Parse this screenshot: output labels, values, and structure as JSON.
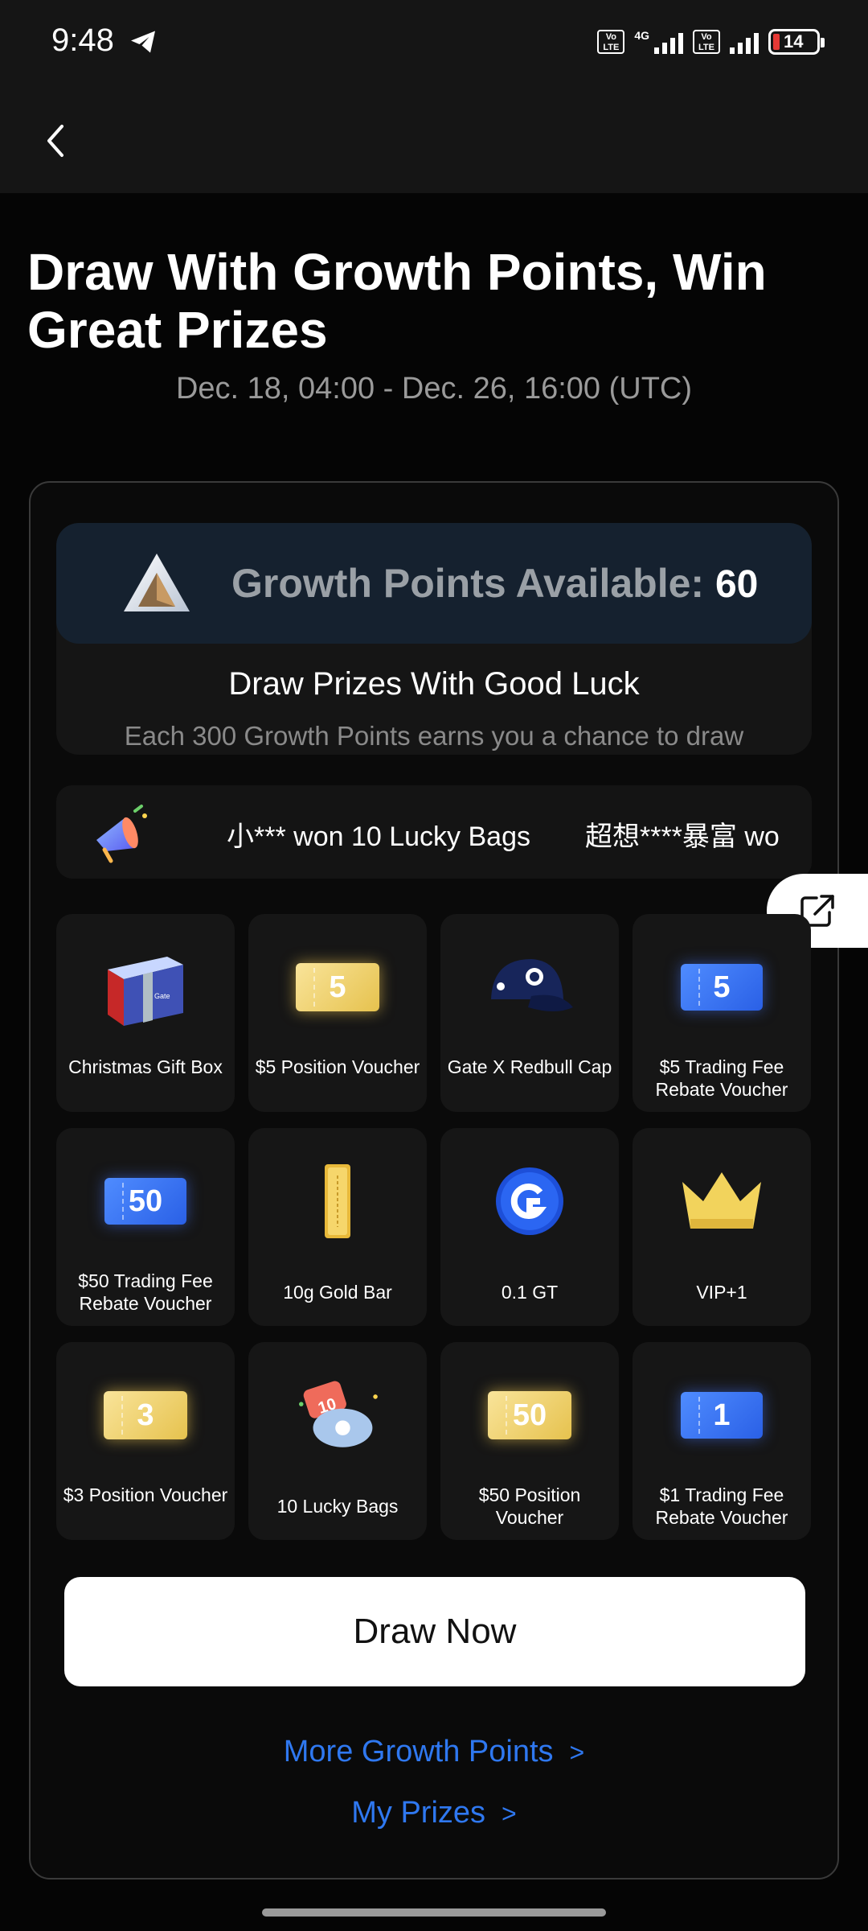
{
  "status_bar": {
    "time": "9:48",
    "network_type": "4G",
    "volte_label": "Vo LTE",
    "battery_level": "14",
    "battery_color": "#e53935"
  },
  "nav": {
    "back_icon": "chevron-left-icon"
  },
  "header": {
    "title": "Draw With Growth Points, Win Great Prizes",
    "date_range": "Dec. 18, 04:00 - Dec. 26, 16:00 (UTC)"
  },
  "points": {
    "label": "Growth Points Available:",
    "value": "60",
    "heading": "Draw Prizes With Good Luck",
    "subtext": "Each 300 Growth Points earns you a chance to draw"
  },
  "ticker": {
    "icon": "megaphone-icon",
    "messages": [
      "小*** won 10 Lucky Bags",
      "超想****暴富 wo"
    ]
  },
  "prizes": [
    {
      "name": "Christmas Gift Box",
      "icon": "gift-box-icon"
    },
    {
      "name": "$5 Position Voucher",
      "icon": "gold-voucher-icon",
      "badge": "5"
    },
    {
      "name": "Gate X Redbull Cap",
      "icon": "cap-icon"
    },
    {
      "name": "$5 Trading Fee Rebate Voucher",
      "icon": "blue-voucher-icon",
      "badge": "5"
    },
    {
      "name": "$50 Trading Fee Rebate Voucher",
      "icon": "blue-voucher-icon",
      "badge": "50"
    },
    {
      "name": "10g Gold Bar",
      "icon": "gold-bar-icon"
    },
    {
      "name": "0.1 GT",
      "icon": "gt-coin-icon"
    },
    {
      "name": "VIP+1",
      "icon": "crown-icon"
    },
    {
      "name": "$3 Position Voucher",
      "icon": "gold-voucher-icon",
      "badge": "3"
    },
    {
      "name": "10 Lucky Bags",
      "icon": "lucky-bags-icon",
      "badge": "10"
    },
    {
      "name": "$50 Position Voucher",
      "icon": "gold-voucher-icon",
      "badge": "50"
    },
    {
      "name": "$1 Trading Fee Rebate Voucher",
      "icon": "blue-voucher-icon",
      "badge": "1"
    }
  ],
  "actions": {
    "draw_now": "Draw Now",
    "more_points": "More Growth Points",
    "my_prizes": "My Prizes",
    "chevron": ">"
  },
  "colors": {
    "accent_link": "#2f78f0",
    "points_panel": "#15212f",
    "background": "#050505"
  }
}
